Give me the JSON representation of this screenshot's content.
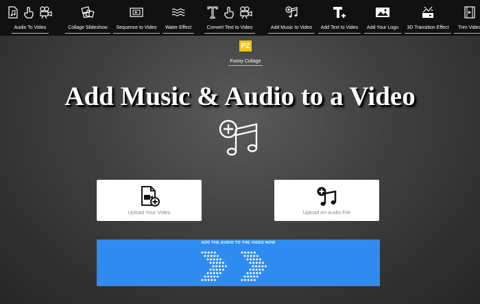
{
  "nav": {
    "items": [
      {
        "label": "Audio To Video",
        "icons": [
          "music-file-icon",
          "hand-pointer-icon",
          "video-camera-icon"
        ]
      },
      {
        "label": "Collage Slideshow",
        "icons": [
          "collage-photos-icon"
        ]
      },
      {
        "label": "Sequence to Video",
        "icons": [
          "film-frame-icon"
        ]
      },
      {
        "label": "Water Effect",
        "icons": [
          "water-waves-icon"
        ]
      },
      {
        "label": "Convert Text to Video",
        "icons": [
          "text-t-icon",
          "hand-pointer-icon",
          "video-camera-icon"
        ]
      },
      {
        "label": "Add Music to Video",
        "icons": [
          "music-add-icon"
        ]
      },
      {
        "label": "Add Text to Video",
        "icons": [
          "text-add-icon"
        ]
      },
      {
        "label": "Add Your Logo",
        "icons": [
          "logo-image-icon"
        ]
      },
      {
        "label": "3D Transition Effect",
        "icons": [
          "transition-icon"
        ]
      },
      {
        "label": "Trim Video",
        "icons": [
          "trim-video-icon"
        ]
      }
    ],
    "sub_item": {
      "label": "Funny Collage",
      "logo_text": "PZ",
      "logo_color": "#f5c518"
    }
  },
  "hero": {
    "title": "Add Music & Audio to a Video",
    "icon": "music-add-icon"
  },
  "uploads": {
    "video": {
      "label": "Upload Your Video",
      "icon": "video-file-add-icon"
    },
    "audio": {
      "label": "Upload An Audio File",
      "icon": "music-note-add-icon"
    }
  },
  "submit": {
    "label": "ADD THE AUDIO TO THE VIDEO NOW",
    "color": "#2f8bf0",
    "icon": "dotted-double-arrow-icon"
  }
}
